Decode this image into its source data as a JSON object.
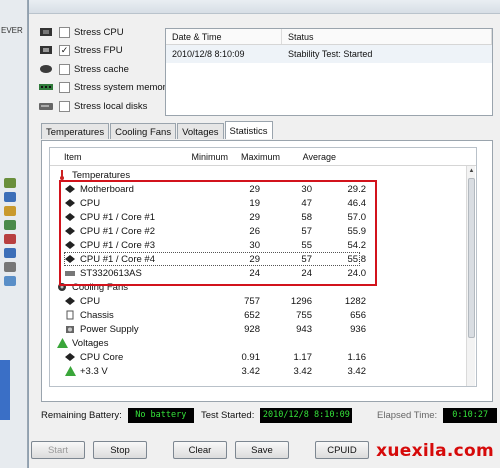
{
  "desktop": {
    "text": "EVER"
  },
  "stress_options": [
    {
      "label": "Stress CPU",
      "checked": false,
      "icon": "cpu-chip-icon"
    },
    {
      "label": "Stress FPU",
      "checked": true,
      "icon": "fpu-chip-icon"
    },
    {
      "label": "Stress cache",
      "checked": false,
      "icon": "cache-icon"
    },
    {
      "label": "Stress system memory",
      "checked": false,
      "icon": "memory-module-icon"
    },
    {
      "label": "Stress local disks",
      "checked": false,
      "icon": "hard-disk-icon"
    }
  ],
  "status_log": {
    "headers": {
      "date": "Date & Time",
      "status": "Status"
    },
    "rows": [
      {
        "date": "2010/12/8 8:10:09",
        "status": "Stability Test: Started"
      }
    ]
  },
  "tabs": [
    {
      "label": "Temperatures",
      "active": false
    },
    {
      "label": "Cooling Fans",
      "active": false
    },
    {
      "label": "Voltages",
      "active": false
    },
    {
      "label": "Statistics",
      "active": true
    }
  ],
  "stats": {
    "headers": {
      "item": "Item",
      "min": "Minimum",
      "max": "Maximum",
      "avg": "Average"
    },
    "rows": [
      {
        "kind": "group",
        "name": "Temperatures",
        "icon": "thermometer-icon"
      },
      {
        "kind": "item",
        "name": "Motherboard",
        "min": "29",
        "max": "30",
        "avg": "29.2",
        "icon": "motherboard-icon"
      },
      {
        "kind": "item",
        "name": "CPU",
        "min": "19",
        "max": "47",
        "avg": "46.4",
        "icon": "cpu-icon"
      },
      {
        "kind": "item",
        "name": "CPU #1 / Core #1",
        "min": "29",
        "max": "58",
        "avg": "57.0",
        "icon": "cpu-core-icon"
      },
      {
        "kind": "item",
        "name": "CPU #1 / Core #2",
        "min": "26",
        "max": "57",
        "avg": "55.9",
        "icon": "cpu-core-icon"
      },
      {
        "kind": "item",
        "name": "CPU #1 / Core #3",
        "min": "30",
        "max": "55",
        "avg": "54.2",
        "icon": "cpu-core-icon"
      },
      {
        "kind": "item",
        "name": "CPU #1 / Core #4",
        "min": "29",
        "max": "57",
        "avg": "55.8",
        "icon": "cpu-core-icon",
        "selected": true
      },
      {
        "kind": "item",
        "name": "ST3320613AS",
        "min": "24",
        "max": "24",
        "avg": "24.0",
        "icon": "hard-disk-icon"
      },
      {
        "kind": "group",
        "name": "Cooling Fans",
        "icon": "fan-icon"
      },
      {
        "kind": "item",
        "name": "CPU",
        "min": "757",
        "max": "1296",
        "avg": "1282",
        "icon": "cpu-icon"
      },
      {
        "kind": "item",
        "name": "Chassis",
        "min": "652",
        "max": "755",
        "avg": "656",
        "icon": "chassis-icon"
      },
      {
        "kind": "item",
        "name": "Power Supply",
        "min": "928",
        "max": "943",
        "avg": "936",
        "icon": "power-supply-icon"
      },
      {
        "kind": "group",
        "name": "Voltages",
        "icon": "voltage-warning-icon"
      },
      {
        "kind": "item",
        "name": "CPU Core",
        "min": "0.91",
        "max": "1.17",
        "avg": "1.16",
        "icon": "cpu-icon"
      },
      {
        "kind": "item",
        "name": "+3.3 V",
        "min": "3.42",
        "max": "3.42",
        "avg": "3.42",
        "icon": "voltage-warning-icon"
      }
    ]
  },
  "status_bar": {
    "battery_label": "Remaining Battery:",
    "battery_value": "No battery",
    "started_label": "Test Started:",
    "started_value": "2010/12/8 8:10:09",
    "elapsed_label": "Elapsed Time:",
    "elapsed_value": "0:10:27"
  },
  "buttons": [
    {
      "label": "Start",
      "disabled": true
    },
    {
      "label": "Stop",
      "disabled": false
    },
    {
      "label": "Clear",
      "disabled": false
    },
    {
      "label": "Save",
      "disabled": false
    },
    {
      "label": "CPUID",
      "disabled": false
    }
  ],
  "watermark": "xuexila.com",
  "colors": {
    "highlight_box": "#d2131c",
    "lcd_text": "#35e23a",
    "lcd_bg": "#000000",
    "watermark": "#d60a0a"
  }
}
